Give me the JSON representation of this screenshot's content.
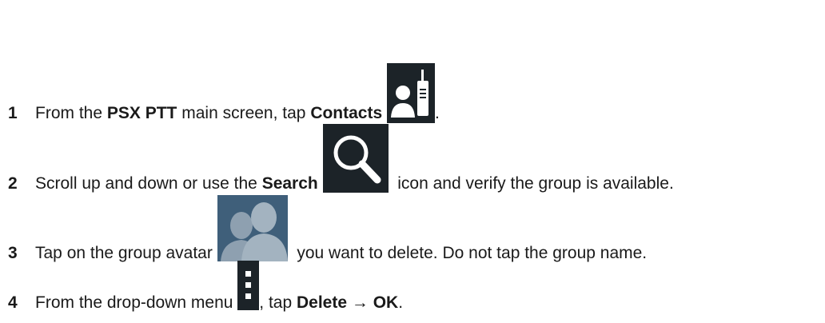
{
  "steps": [
    {
      "number": "1",
      "pre": "From the ",
      "bold1": "PSX PTT",
      "mid": " main screen, tap ",
      "bold2": "Contacts",
      "post": ".",
      "icon": "contacts-radio-icon"
    },
    {
      "number": "2",
      "pre": "Scroll up and down or use the ",
      "bold1": "Search",
      "post": " icon and verify the group is available.",
      "icon": "search-icon"
    },
    {
      "number": "3",
      "pre": "Tap on the group avatar ",
      "post": " you want to delete. Do not tap the group name.",
      "icon": "group-avatar-icon"
    },
    {
      "number": "4",
      "pre": "From the drop-down menu ",
      "mid": ", tap ",
      "bold1": "Delete",
      "arrow": " → ",
      "bold2": "OK",
      "post": ".",
      "icon": "overflow-menu-icon"
    }
  ],
  "colors": {
    "icon_bg": "#1c2328",
    "avatar_bg": "#3f5f7a",
    "avatar_fg": "#8ea0b0"
  }
}
